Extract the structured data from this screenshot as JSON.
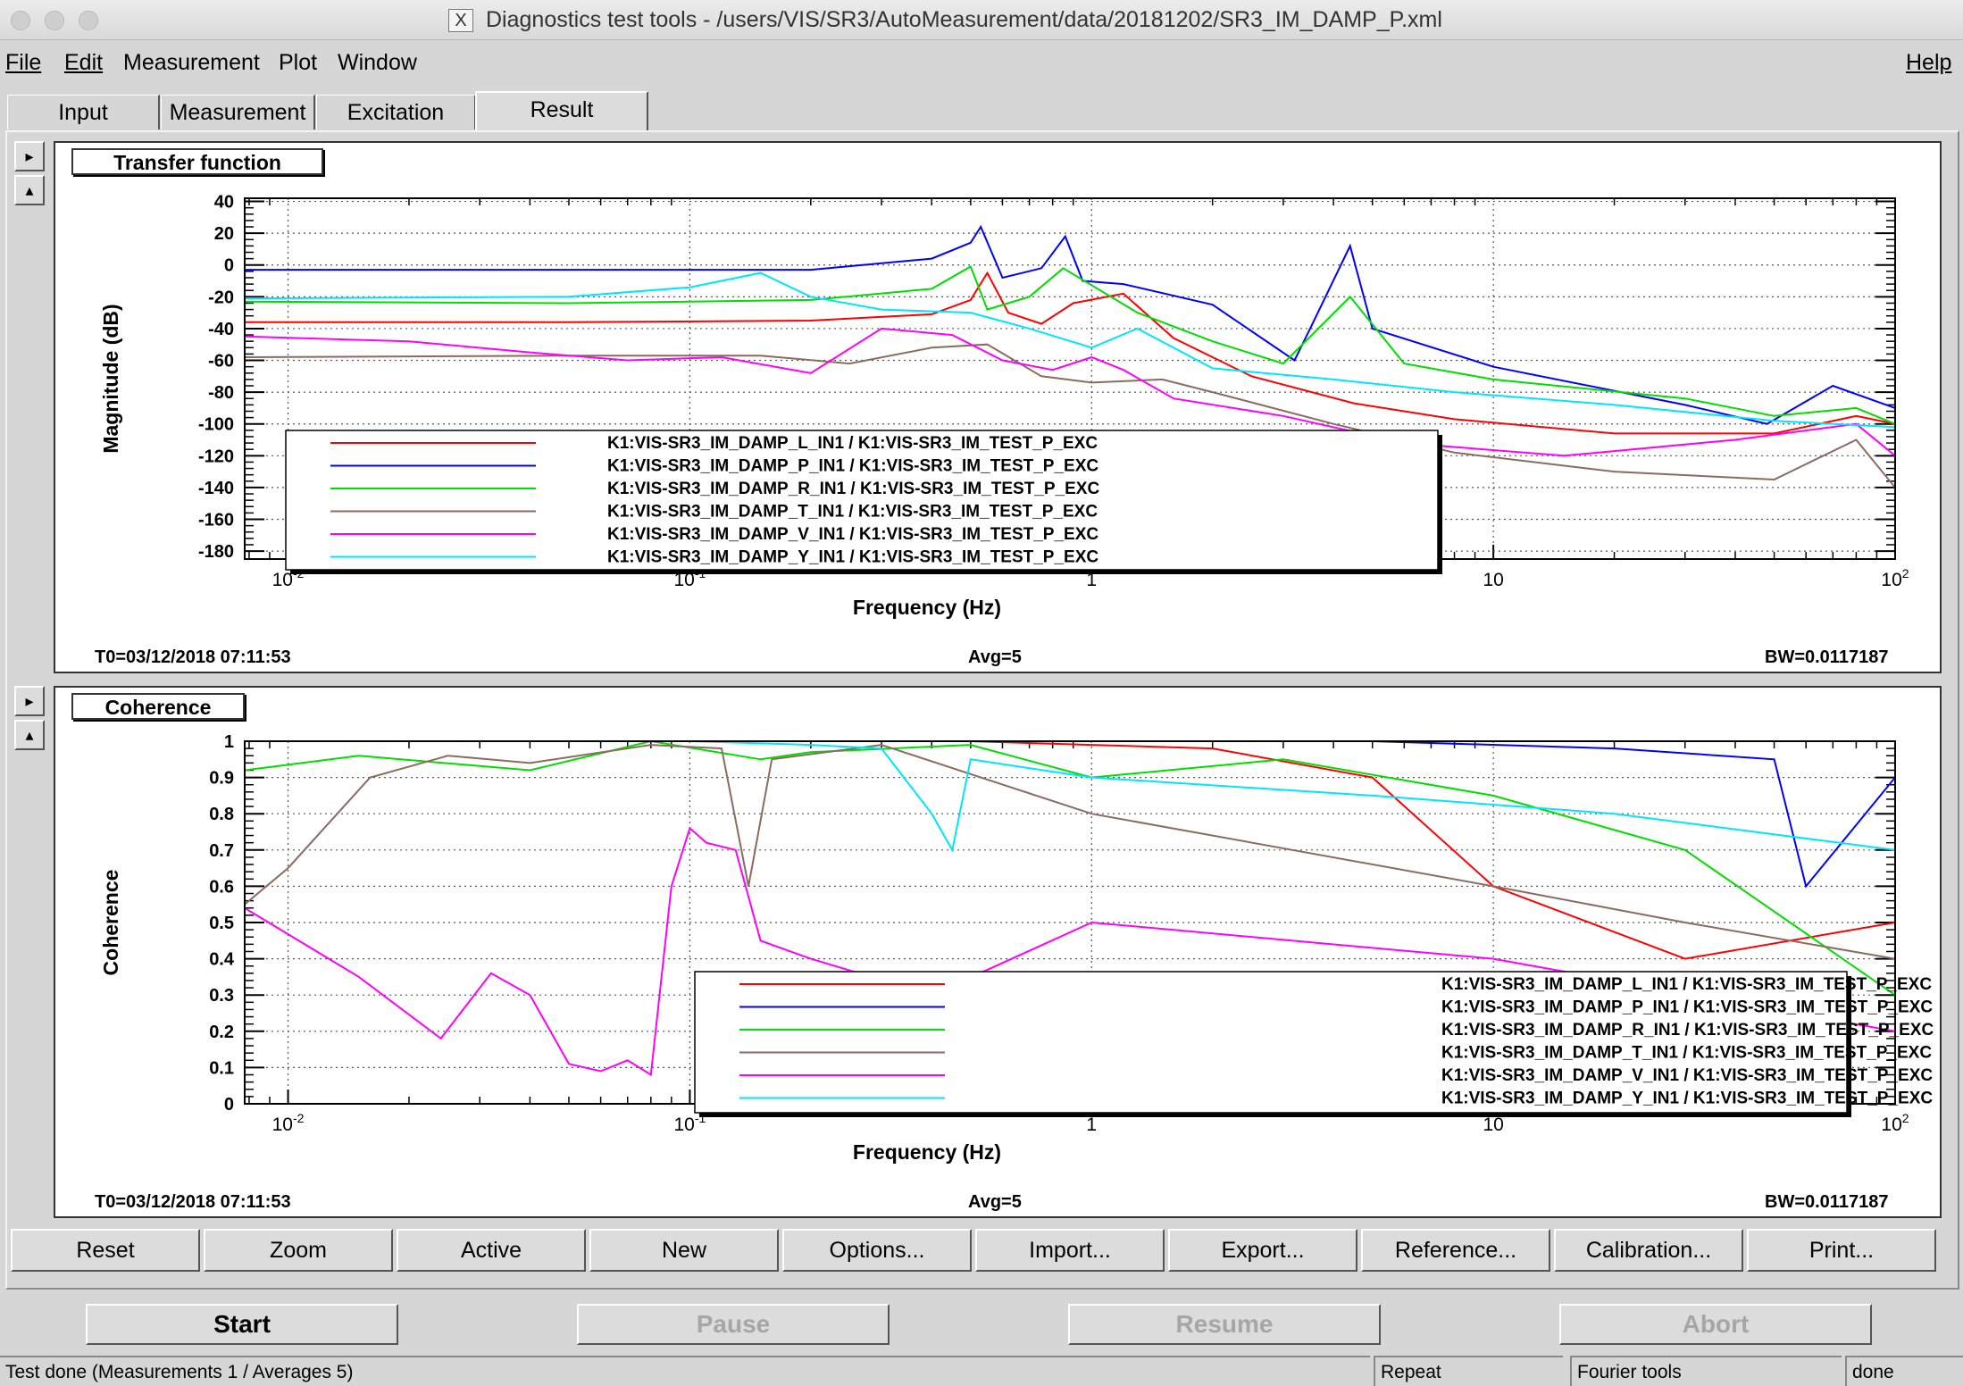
{
  "window": {
    "title": "Diagnostics test tools - /users/VIS/SR3/AutoMeasurement/data/20181202/SR3_IM_DAMP_P.xml",
    "x_glyph": "X"
  },
  "menu": {
    "file": "File",
    "edit": "Edit",
    "measurement": "Measurement",
    "plot": "Plot",
    "window": "Window",
    "help": "Help"
  },
  "tabs": [
    "Input",
    "Measurement",
    "Excitation",
    "Result"
  ],
  "pad": {
    "right_arrow": "▸",
    "up_arrow": "▴"
  },
  "panels": {
    "transfer": {
      "title": "Transfer function",
      "t0": "T0=03/12/2018 07:11:53",
      "avg": "Avg=5",
      "bw": "BW=0.0117187"
    },
    "coherence": {
      "title": "Coherence",
      "t0": "T0=03/12/2018 07:11:53",
      "avg": "Avg=5",
      "bw": "BW=0.0117187"
    }
  },
  "toolbar": [
    "Reset",
    "Zoom",
    "Active",
    "New",
    "Options...",
    "Import...",
    "Export...",
    "Reference...",
    "Calibration...",
    "Print..."
  ],
  "controls": {
    "start": "Start",
    "pause": "Pause",
    "resume": "Resume",
    "abort": "Abort"
  },
  "status": {
    "message": "Test done (Measurements 1 / Averages 5)",
    "repeat": "Repeat",
    "tools": "Fourier tools",
    "state": "done"
  },
  "chart_data": [
    {
      "type": "line",
      "title": "Transfer function",
      "xlabel": "Frequency (Hz)",
      "ylabel": "Magnitude (dB)",
      "xscale": "log",
      "xlim": [
        0.0078,
        100
      ],
      "ylim": [
        -185,
        42
      ],
      "xticks": [
        0.01,
        0.1,
        1,
        10,
        100
      ],
      "xtick_labels": [
        "10",
        "10",
        "1",
        "10",
        "10"
      ],
      "xtick_exps": [
        "-2",
        "-1",
        "",
        "",
        "2"
      ],
      "yticks": [
        40,
        20,
        0,
        -20,
        -40,
        -60,
        -80,
        -100,
        -120,
        -140,
        -160,
        -180
      ],
      "grid": true,
      "legend": "center-left",
      "series": [
        {
          "name": "K1:VIS-SR3_IM_DAMP_L_IN1 / K1:VIS-SR3_IM_TEST_P_EXC",
          "color": "#ff0000",
          "x": [
            0.0078,
            0.05,
            0.2,
            0.4,
            0.5,
            0.55,
            0.62,
            0.75,
            0.9,
            1.2,
            1.6,
            2.5,
            4.5,
            8,
            20,
            50,
            80,
            100
          ],
          "y": [
            -36,
            -36,
            -35,
            -31,
            -22,
            -5,
            -30,
            -37,
            -24,
            -18,
            -46,
            -70,
            -87,
            -97,
            -106,
            -106,
            -95,
            -100
          ]
        },
        {
          "name": "K1:VIS-SR3_IM_DAMP_P_IN1 / K1:VIS-SR3_IM_TEST_P_EXC",
          "color": "#0000ff",
          "x": [
            0.0078,
            0.05,
            0.2,
            0.4,
            0.5,
            0.53,
            0.6,
            0.75,
            0.86,
            0.95,
            1.2,
            2,
            3.2,
            3.5,
            4.4,
            5,
            10,
            30,
            48,
            70,
            100
          ],
          "y": [
            -3,
            -3,
            -3,
            4,
            14,
            24,
            -8,
            -2,
            18,
            -10,
            -12,
            -25,
            -60,
            -40,
            12,
            -40,
            -64,
            -88,
            -100,
            -76,
            -90
          ]
        },
        {
          "name": "K1:VIS-SR3_IM_DAMP_R_IN1 / K1:VIS-SR3_IM_TEST_P_EXC",
          "color": "#00dd00",
          "x": [
            0.0078,
            0.05,
            0.2,
            0.4,
            0.5,
            0.55,
            0.7,
            0.85,
            1.3,
            2,
            3,
            4.4,
            6,
            10,
            30,
            50,
            80,
            100
          ],
          "y": [
            -23,
            -24,
            -22,
            -15,
            -1,
            -28,
            -20,
            -2,
            -30,
            -48,
            -62,
            -20,
            -62,
            -72,
            -84,
            -95,
            -90,
            -100
          ]
        },
        {
          "name": "K1:VIS-SR3_IM_DAMP_T_IN1 / K1:VIS-SR3_IM_TEST_P_EXC",
          "color": "#8b6b60",
          "x": [
            0.0078,
            0.05,
            0.15,
            0.25,
            0.4,
            0.55,
            0.75,
            1,
            1.5,
            2,
            4,
            8,
            20,
            50,
            80,
            100
          ],
          "y": [
            -58,
            -57,
            -57,
            -62,
            -52,
            -50,
            -70,
            -74,
            -72,
            -80,
            -100,
            -118,
            -130,
            -135,
            -110,
            -140
          ]
        },
        {
          "name": "K1:VIS-SR3_IM_DAMP_V_IN1 / K1:VIS-SR3_IM_TEST_P_EXC",
          "color": "#ff00ff",
          "x": [
            0.0078,
            0.02,
            0.04,
            0.07,
            0.12,
            0.2,
            0.3,
            0.45,
            0.6,
            0.8,
            1,
            1.2,
            1.6,
            3,
            6,
            15,
            40,
            80,
            100
          ],
          "y": [
            -45,
            -48,
            -55,
            -60,
            -58,
            -68,
            -40,
            -44,
            -60,
            -66,
            -58,
            -66,
            -84,
            -95,
            -112,
            -120,
            -110,
            -100,
            -120
          ]
        },
        {
          "name": "K1:VIS-SR3_IM_DAMP_Y_IN1 / K1:VIS-SR3_IM_TEST_P_EXC",
          "color": "#00e5ff",
          "x": [
            0.0078,
            0.05,
            0.1,
            0.15,
            0.2,
            0.3,
            0.5,
            0.7,
            1,
            1.3,
            2,
            4,
            8,
            20,
            50,
            100
          ],
          "y": [
            -21,
            -20,
            -14,
            -5,
            -20,
            -28,
            -30,
            -40,
            -52,
            -40,
            -65,
            -72,
            -80,
            -88,
            -98,
            -102
          ]
        }
      ]
    },
    {
      "type": "line",
      "title": "Coherence",
      "xlabel": "Frequency (Hz)",
      "ylabel": "Coherence",
      "xscale": "log",
      "xlim": [
        0.0078,
        100
      ],
      "ylim": [
        0,
        1
      ],
      "xticks": [
        0.01,
        0.1,
        1,
        10,
        100
      ],
      "xtick_labels": [
        "10",
        "10",
        "1",
        "10",
        "10"
      ],
      "xtick_exps": [
        "-2",
        "-1",
        "",
        "",
        "2"
      ],
      "yticks": [
        1,
        0.9,
        0.8,
        0.7,
        0.6,
        0.5,
        0.4,
        0.3,
        0.2,
        0.1,
        0
      ],
      "grid": true,
      "legend": "bottom-right",
      "series": [
        {
          "name": "K1:VIS-SR3_IM_DAMP_L_IN1 / K1:VIS-SR3_IM_TEST_P_EXC",
          "color": "#ff0000",
          "x": [
            0.0078,
            0.1,
            0.5,
            1,
            2,
            5,
            10,
            30,
            100
          ],
          "y": [
            1,
            1,
            1,
            0.99,
            0.98,
            0.9,
            0.6,
            0.4,
            0.5
          ]
        },
        {
          "name": "K1:VIS-SR3_IM_DAMP_P_IN1 / K1:VIS-SR3_IM_TEST_P_EXC",
          "color": "#0000ff",
          "x": [
            0.0078,
            0.1,
            0.5,
            1,
            5,
            20,
            50,
            60,
            100
          ],
          "y": [
            1,
            1,
            1,
            1,
            1,
            0.98,
            0.95,
            0.6,
            0.9
          ]
        },
        {
          "name": "K1:VIS-SR3_IM_DAMP_R_IN1 / K1:VIS-SR3_IM_TEST_P_EXC",
          "color": "#00dd00",
          "x": [
            0.0078,
            0.015,
            0.04,
            0.08,
            0.15,
            0.2,
            0.5,
            1,
            3,
            10,
            30,
            100
          ],
          "y": [
            0.92,
            0.96,
            0.92,
            1,
            0.95,
            0.97,
            0.99,
            0.9,
            0.95,
            0.85,
            0.7,
            0.3
          ]
        },
        {
          "name": "K1:VIS-SR3_IM_DAMP_T_IN1 / K1:VIS-SR3_IM_TEST_P_EXC",
          "color": "#8b6b60",
          "x": [
            0.0078,
            0.01,
            0.016,
            0.025,
            0.04,
            0.08,
            0.12,
            0.14,
            0.16,
            0.3,
            1,
            10,
            30,
            100
          ],
          "y": [
            0.55,
            0.65,
            0.9,
            0.96,
            0.94,
            0.99,
            0.98,
            0.6,
            0.95,
            0.99,
            0.8,
            0.6,
            0.5,
            0.4
          ]
        },
        {
          "name": "K1:VIS-SR3_IM_DAMP_V_IN1 / K1:VIS-SR3_IM_TEST_P_EXC",
          "color": "#ff00ff",
          "x": [
            0.0078,
            0.015,
            0.024,
            0.032,
            0.04,
            0.05,
            0.06,
            0.07,
            0.08,
            0.09,
            0.1,
            0.11,
            0.13,
            0.15,
            0.2,
            0.4,
            1,
            10,
            100
          ],
          "y": [
            0.54,
            0.35,
            0.18,
            0.36,
            0.3,
            0.11,
            0.09,
            0.12,
            0.08,
            0.6,
            0.76,
            0.72,
            0.7,
            0.45,
            0.4,
            0.3,
            0.5,
            0.4,
            0.2
          ]
        },
        {
          "name": "K1:VIS-SR3_IM_DAMP_Y_IN1 / K1:VIS-SR3_IM_TEST_P_EXC",
          "color": "#00e5ff",
          "x": [
            0.0078,
            0.1,
            0.2,
            0.3,
            0.4,
            0.45,
            0.5,
            1,
            5,
            20,
            100
          ],
          "y": [
            1,
            1,
            0.99,
            0.98,
            0.8,
            0.7,
            0.95,
            0.9,
            0.85,
            0.8,
            0.7
          ]
        }
      ]
    }
  ]
}
